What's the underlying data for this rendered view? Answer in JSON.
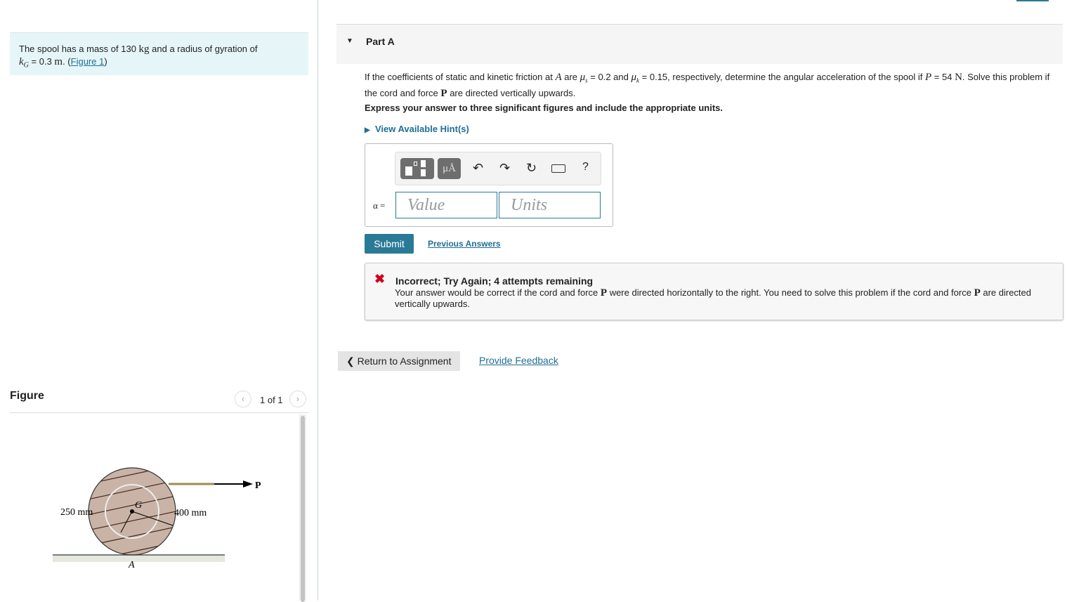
{
  "problem": {
    "intro_1": "The spool has a mass of 130 ",
    "kg": "kg",
    "intro_2": " and a radius of gyration of",
    "kG": "k",
    "kG_sub": "G",
    "kG_value": " = 0.3 ",
    "m": "m",
    "period": ". (",
    "figure_link": "Figure 1",
    ")": ")"
  },
  "figure": {
    "title": "Figure",
    "pager": "1 of 1",
    "label_250": "250 mm",
    "label_400": "400 mm",
    "label_G": "G",
    "label_A": "A",
    "label_P": "P"
  },
  "part": {
    "title": "Part A",
    "q1": "If the coefficients of static and kinetic friction at ",
    "A": "A",
    "q2": " are ",
    "mus": "μ",
    "s": "s",
    "q3": " = 0.2 and ",
    "k": "k",
    "q4": " = 0.15, respectively, determine the angular acceleration of the spool if ",
    "P": "P",
    "q5": " = 54 ",
    "N": "N",
    "q6": ". Solve this problem if the cord and force ",
    "Pb": "P",
    "q7": " are directed vertically upwards.",
    "instructions": "Express your answer to three significant figures and include the appropriate units.",
    "hints": "View Available Hint(s)"
  },
  "answer": {
    "label": "α =",
    "value_placeholder": "Value",
    "units_placeholder": "Units",
    "units_btn": "μÅ",
    "help": "?"
  },
  "actions": {
    "submit": "Submit",
    "previous": "Previous Answers",
    "return": "Return to Assignment",
    "feedback": "Provide Feedback"
  },
  "feedback": {
    "title": "Incorrect; Try Again; 4 attempts remaining",
    "t1": "Your answer would be correct if the cord and force ",
    "P": "P",
    "t2": " were directed horizontally to the right. You need to solve this problem if the cord and force ",
    "P2": "P",
    "t3": " are directed vertically upwards.",
    "color": "#d0021b"
  }
}
